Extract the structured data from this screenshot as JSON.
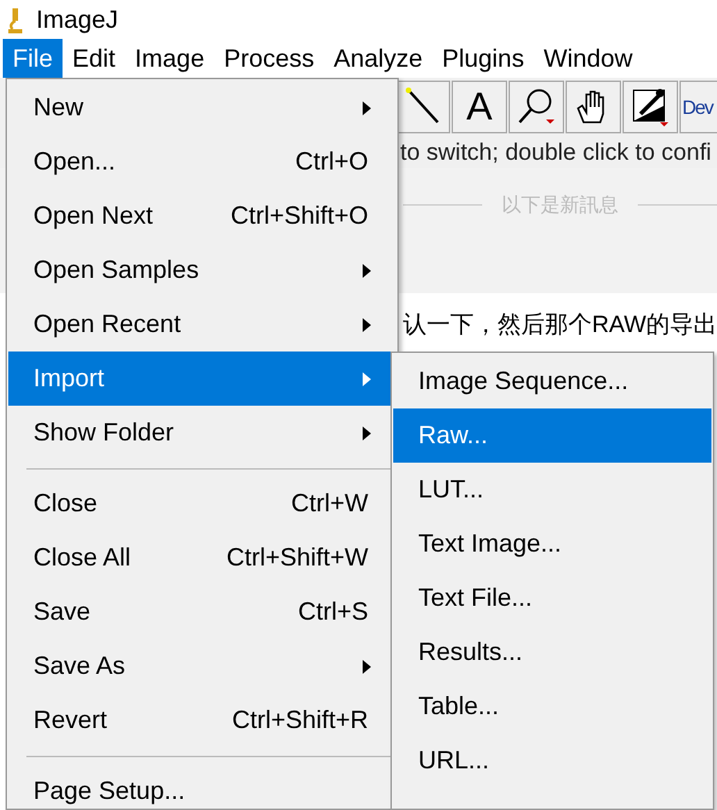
{
  "window": {
    "title": "ImageJ"
  },
  "menubar": [
    {
      "label": "File",
      "selected": true
    },
    {
      "label": "Edit",
      "selected": false
    },
    {
      "label": "Image",
      "selected": false
    },
    {
      "label": "Process",
      "selected": false
    },
    {
      "label": "Analyze",
      "selected": false
    },
    {
      "label": "Plugins",
      "selected": false
    },
    {
      "label": "Window",
      "selected": false
    }
  ],
  "toolbar": [
    {
      "kind": "wand"
    },
    {
      "kind": "text",
      "label": "A"
    },
    {
      "kind": "zoom"
    },
    {
      "kind": "hand"
    },
    {
      "kind": "picker"
    },
    {
      "kind": "dev",
      "label": "Dev"
    }
  ],
  "status_bar": "to switch; double click to confi",
  "background": {
    "divider": "以下是新訊息",
    "message": "认一下，然后那个RAW的导出"
  },
  "file_menu": [
    {
      "kind": "item",
      "label": "New",
      "submenu": true,
      "selected": false
    },
    {
      "kind": "item",
      "label": "Open...",
      "shortcut": "Ctrl+O",
      "selected": false
    },
    {
      "kind": "item",
      "label": "Open Next",
      "shortcut": "Ctrl+Shift+O",
      "selected": false
    },
    {
      "kind": "item",
      "label": "Open Samples",
      "submenu": true,
      "selected": false
    },
    {
      "kind": "item",
      "label": "Open Recent",
      "submenu": true,
      "selected": false
    },
    {
      "kind": "item",
      "label": "Import",
      "submenu": true,
      "selected": true
    },
    {
      "kind": "item",
      "label": "Show Folder",
      "submenu": true,
      "selected": false
    },
    {
      "kind": "separator"
    },
    {
      "kind": "item",
      "label": "Close",
      "shortcut": "Ctrl+W",
      "selected": false
    },
    {
      "kind": "item",
      "label": "Close All",
      "shortcut": "Ctrl+Shift+W",
      "selected": false
    },
    {
      "kind": "item",
      "label": "Save",
      "shortcut": "Ctrl+S",
      "selected": false
    },
    {
      "kind": "item",
      "label": "Save As",
      "submenu": true,
      "selected": false
    },
    {
      "kind": "item",
      "label": "Revert",
      "shortcut": "Ctrl+Shift+R",
      "selected": false
    },
    {
      "kind": "separator"
    },
    {
      "kind": "item",
      "label": "Page Setup...",
      "selected": false
    }
  ],
  "import_menu": [
    {
      "label": "Image Sequence...",
      "selected": false
    },
    {
      "label": "Raw...",
      "selected": true
    },
    {
      "label": "LUT...",
      "selected": false
    },
    {
      "label": "Text Image...",
      "selected": false
    },
    {
      "label": "Text File...",
      "selected": false
    },
    {
      "label": "Results...",
      "selected": false
    },
    {
      "label": "Table...",
      "selected": false
    },
    {
      "label": "URL...",
      "selected": false
    }
  ]
}
